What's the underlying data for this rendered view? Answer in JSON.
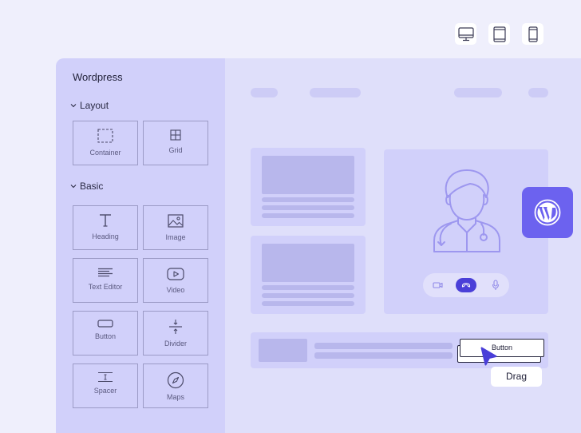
{
  "devices": [
    {
      "icon": "desktop-icon",
      "label": "Desktop"
    },
    {
      "icon": "tablet-icon",
      "label": "Tablet"
    },
    {
      "icon": "mobile-icon",
      "label": "Mobile"
    }
  ],
  "sidebar": {
    "title": "Wordpress",
    "sections": [
      {
        "title": "Layout",
        "expanded": true,
        "widgets": [
          "Container",
          "Grid"
        ]
      },
      {
        "title": "Basic",
        "expanded": true,
        "widgets": [
          "Heading",
          "Image",
          "Text Editor",
          "Video",
          "Button",
          "Divider",
          "Spacer",
          "Maps"
        ]
      }
    ]
  },
  "drag": {
    "element_label": "Button",
    "tooltip": "Drag"
  },
  "colors": {
    "page_background": "#efeffc",
    "sidebar": "#d1d0fa",
    "canvas": "#dfdffa",
    "placeholder": "#b8b7ec",
    "accent": "#6c62ef",
    "call_button": "#4a3fd8",
    "illustration": "#9d97ef"
  },
  "icons": {
    "wordpress_badge": "wordpress-logo-icon",
    "illustration": "doctor-icon",
    "call_controls": [
      "video-camera-icon",
      "hang-up-icon",
      "microphone-icon"
    ],
    "cursor": "cursor-arrow-icon"
  }
}
